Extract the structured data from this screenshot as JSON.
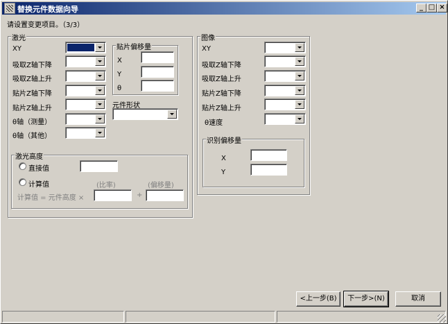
{
  "window": {
    "title": "替换元件数据向导",
    "min_icon": "minimize-icon",
    "max_icon": "maximize-icon",
    "close_icon": "close-icon"
  },
  "instruction": "请设置变更项目。（3/3）",
  "laser": {
    "title": "激光",
    "rows": [
      {
        "label": "XY",
        "name": "laser-xy"
      },
      {
        "label": "吸取Z轴下降",
        "name": "laser-pick-z-down"
      },
      {
        "label": "吸取Z轴上升",
        "name": "laser-pick-z-up"
      },
      {
        "label": "贴片Z轴下降",
        "name": "laser-mount-z-down"
      },
      {
        "label": "贴片Z轴上升",
        "name": "laser-mount-z-up"
      },
      {
        "label": "θ轴（测量）",
        "name": "laser-theta-measure"
      },
      {
        "label": "θ轴（其他）",
        "name": "laser-theta-other"
      }
    ],
    "offset": {
      "title": "贴片偏移量",
      "x_label": "X",
      "y_label": "Y",
      "theta_label": "θ"
    },
    "shape_label": "元件形状",
    "height": {
      "title": "激光高度",
      "direct_label": "直接值",
      "calc_label": "计算值",
      "ratio_label": "(比率)",
      "offset_label": "(偏移量)",
      "formula_label": "计算值 = 元件高度 ×",
      "plus_label": "+"
    }
  },
  "image": {
    "title": "图像",
    "rows": [
      {
        "label": "XY",
        "name": "image-xy"
      },
      {
        "label": "吸取Z轴下降",
        "name": "image-pick-z-down"
      },
      {
        "label": "吸取Z轴上升",
        "name": "image-pick-z-up"
      },
      {
        "label": "贴片Z轴下降",
        "name": "image-mount-z-down"
      },
      {
        "label": "贴片Z轴上升",
        "name": "image-mount-z-up"
      },
      {
        "label": "θ速度",
        "name": "image-theta-speed"
      }
    ],
    "recog": {
      "title": "识别偏移量",
      "x_label": "X",
      "y_label": "Y"
    }
  },
  "buttons": {
    "back": "<上一步(B)",
    "next": "下一步>(N)",
    "cancel": "取消"
  }
}
